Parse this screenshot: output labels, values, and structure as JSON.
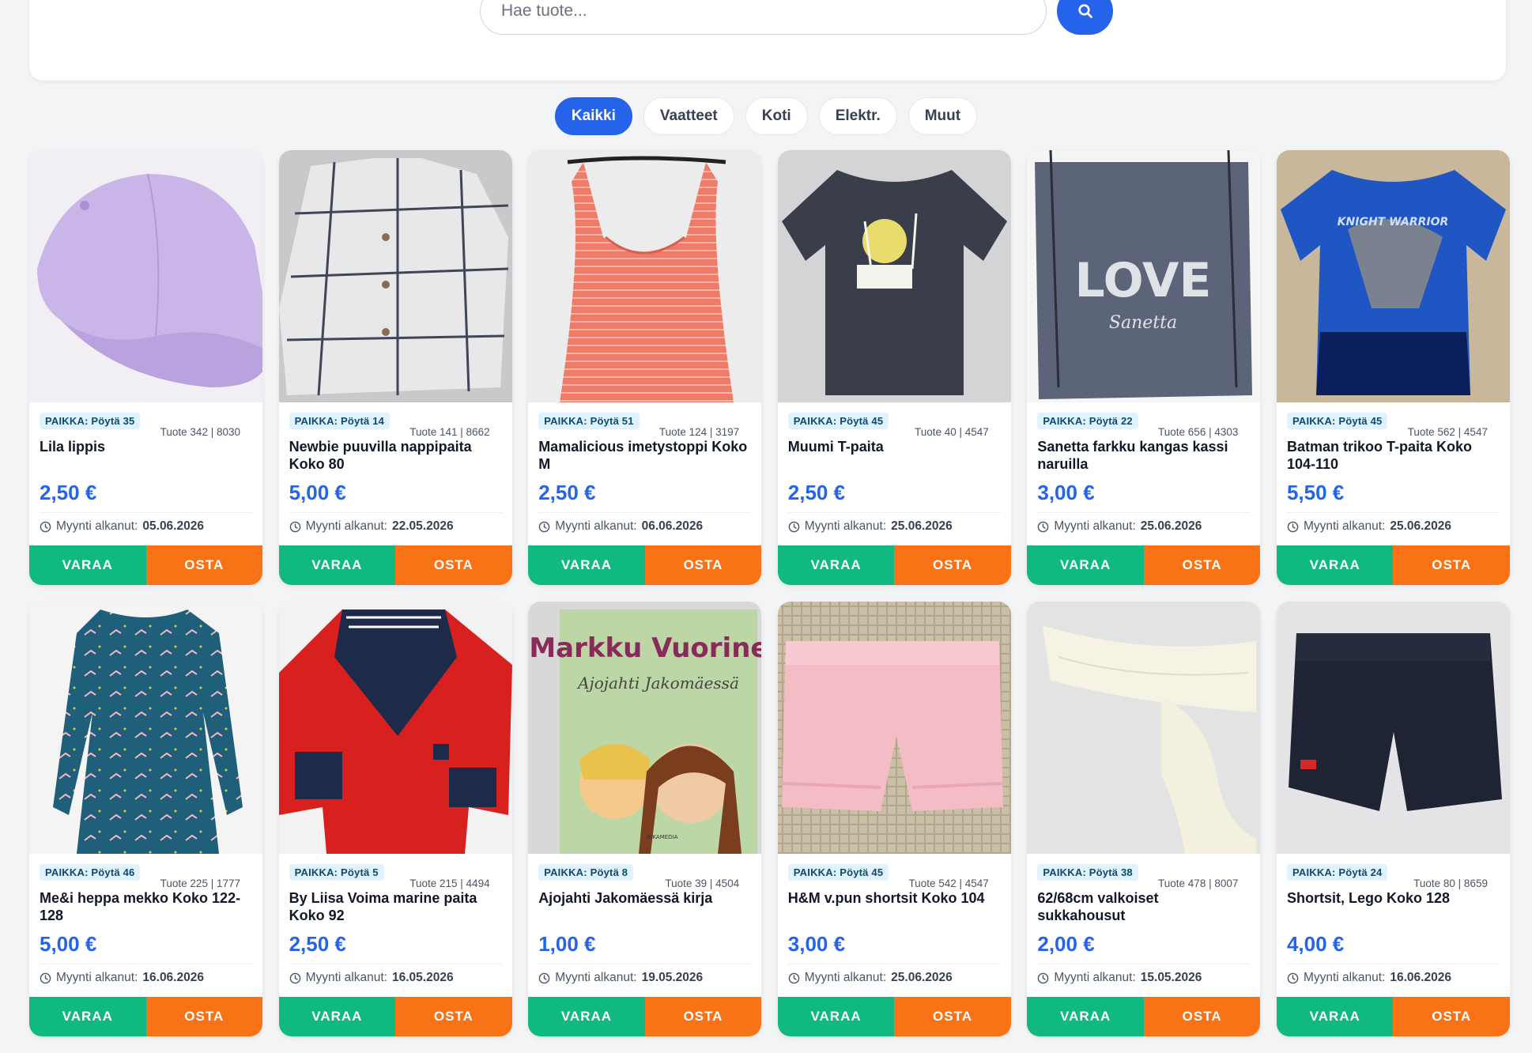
{
  "search": {
    "placeholder": "Hae tuote..."
  },
  "filters": [
    {
      "label": "Kaikki",
      "active": true
    },
    {
      "label": "Vaatteet",
      "active": false
    },
    {
      "label": "Koti",
      "active": false
    },
    {
      "label": "Elektr.",
      "active": false
    },
    {
      "label": "Muut",
      "active": false
    }
  ],
  "labels": {
    "since": "Myynti alkanut:",
    "reserve": "VARAA",
    "buy": "OSTA"
  },
  "products": [
    {
      "location": "PAIKKA: Pöytä 35",
      "code": "Tuote 342 | 8030",
      "title": "Lila lippis",
      "price": "2,50 €",
      "since_date": "05.06.2026",
      "image": "lilac-cap"
    },
    {
      "location": "PAIKKA: Pöytä 14",
      "code": "Tuote 141 | 8662",
      "title": "Newbie puuvilla nappipaita Koko 80",
      "price": "5,00 €",
      "since_date": "22.05.2026",
      "image": "plaid-shirt"
    },
    {
      "location": "PAIKKA: Pöytä 51",
      "code": "Tuote 124 | 3197",
      "title": "Mamalicious imetystoppi Koko M",
      "price": "2,50 €",
      "since_date": "06.06.2026",
      "image": "striped-tank-top"
    },
    {
      "location": "PAIKKA: Pöytä 45",
      "code": "Tuote 40 | 4547",
      "title": "Muumi T-paita",
      "price": "2,50 €",
      "since_date": "25.06.2026",
      "image": "navy-moomin-tshirt"
    },
    {
      "location": "PAIKKA: Pöytä 22",
      "code": "Tuote 656 | 4303",
      "title": "Sanetta farkku kangas kassi naruilla",
      "price": "3,00 €",
      "since_date": "25.06.2026",
      "image": "denim-drawstring-bag"
    },
    {
      "location": "PAIKKA: Pöytä 45",
      "code": "Tuote 562 | 4547",
      "title": "Batman trikoo T-paita Koko 104-110",
      "price": "5,50 €",
      "since_date": "25.06.2026",
      "image": "batman-tshirt"
    },
    {
      "location": "PAIKKA: Pöytä 46",
      "code": "Tuote 225 | 1777",
      "title": "Me&i heppa mekko Koko 122-128",
      "price": "5,00 €",
      "since_date": "16.06.2026",
      "image": "teal-horse-dress"
    },
    {
      "location": "PAIKKA: Pöytä 5",
      "code": "Tuote 215 | 4494",
      "title": "By Liisa Voima marine paita Koko 92",
      "price": "2,50 €",
      "since_date": "16.05.2026",
      "image": "red-sailor-shirt"
    },
    {
      "location": "PAIKKA: Pöytä 8",
      "code": "Tuote 39 | 4504",
      "title": "Ajojahti Jakomäessä kirja",
      "price": "1,00 €",
      "since_date": "19.05.2026",
      "image": "book-cover"
    },
    {
      "location": "PAIKKA: Pöytä 45",
      "code": "Tuote 542 | 4547",
      "title": "H&M v.pun shortsit Koko 104",
      "price": "3,00 €",
      "since_date": "25.06.2026",
      "image": "pink-shorts"
    },
    {
      "location": "PAIKKA: Pöytä 38",
      "code": "Tuote 478 | 8007",
      "title": "62/68cm valkoiset sukkahousut",
      "price": "2,00 €",
      "since_date": "15.05.2026",
      "image": "white-tights"
    },
    {
      "location": "PAIKKA: Pöytä 24",
      "code": "Tuote 80 | 8659",
      "title": "Shortsit, Lego Koko 128",
      "price": "4,00 €",
      "since_date": "16.06.2026",
      "image": "navy-shorts"
    }
  ],
  "book_cover": {
    "author": "Markku Vuorinen",
    "title": "Ajojahti Jakomäessä",
    "publisher": "BIKAMEDIA"
  },
  "bag_print": {
    "word": "LOVE",
    "brand": "Sanetta"
  },
  "tshirt_print": "KNIGHT WARRIOR"
}
